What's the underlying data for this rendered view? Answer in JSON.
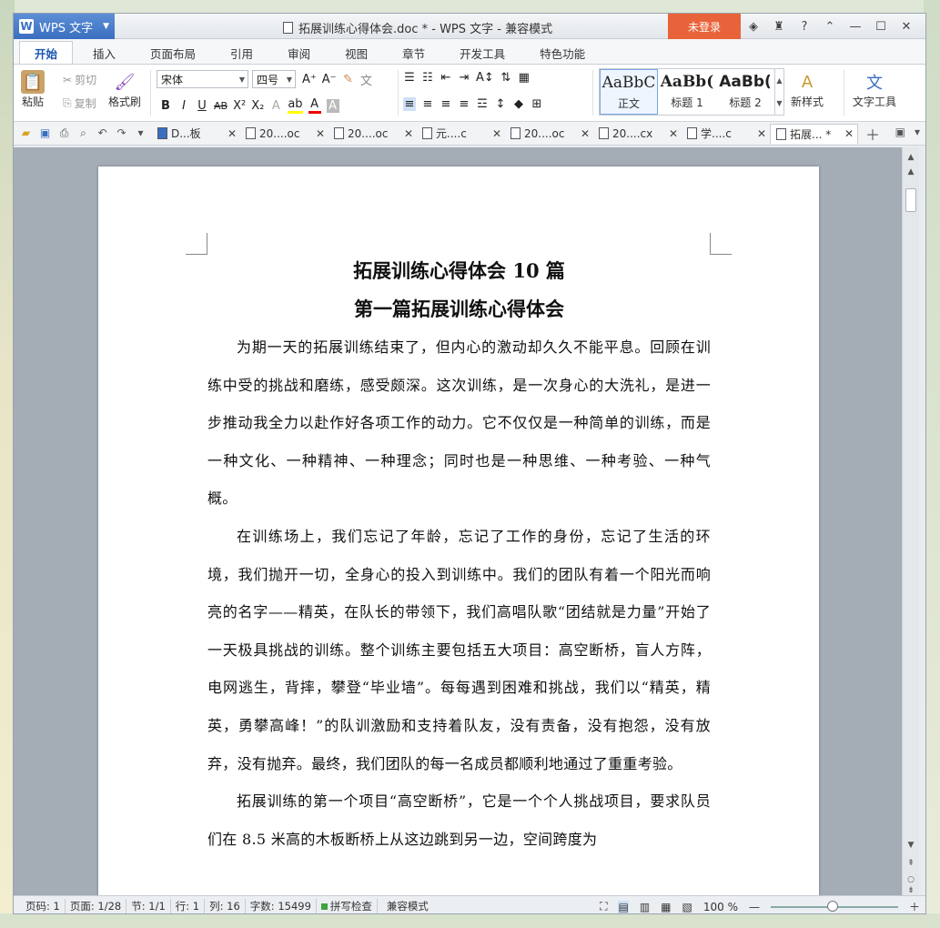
{
  "window": {
    "app_button": "WPS 文字",
    "title": "拓展训练心得体会.doc * - WPS 文字 - 兼容模式",
    "login": "未登录"
  },
  "ribbon_tabs": [
    "开始",
    "插入",
    "页面布局",
    "引用",
    "审阅",
    "视图",
    "章节",
    "开发工具",
    "特色功能"
  ],
  "ribbon": {
    "paste": "粘贴",
    "cut": "剪切",
    "copy": "复制",
    "format_painter": "格式刷",
    "font": "宋体",
    "size": "四号",
    "styles": [
      {
        "preview": "AaBbC",
        "label": "正文"
      },
      {
        "preview": "AaBb(",
        "label": "标题 1"
      },
      {
        "preview": "AaBb(",
        "label": "标题 2"
      }
    ],
    "new_style": "新样式",
    "text_tools": "文字工具"
  },
  "doc_tabs": [
    {
      "label": "D...板",
      "active": false
    },
    {
      "label": "20....oc",
      "active": false
    },
    {
      "label": "20....oc",
      "active": false
    },
    {
      "label": "元....c",
      "active": false
    },
    {
      "label": "20....oc",
      "active": false
    },
    {
      "label": "20....cx",
      "active": false
    },
    {
      "label": "学....c",
      "active": false
    },
    {
      "label": "拓展... *",
      "active": true
    }
  ],
  "document": {
    "title1": "拓展训练心得体会 10 篇",
    "title2": "第一篇拓展训练心得体会",
    "paragraphs": [
      "为期一天的拓展训练结束了，但内心的激动却久久不能平息。回顾在训练中受的挑战和磨练，感受颇深。这次训练，是一次身心的大洗礼，是进一步推动我全力以赴作好各项工作的动力。它不仅仅是一种简单的训练，而是一种文化、一种精神、一种理念；同时也是一种思维、一种考验、一种气概。",
      "在训练场上，我们忘记了年龄，忘记了工作的身份，忘记了生活的环境，我们抛开一切，全身心的投入到训练中。我们的团队有着一个阳光而响亮的名字——精英，在队长的带领下，我们高唱队歌“团结就是力量”开始了一天极具挑战的训练。整个训练主要包括五大项目：高空断桥，盲人方阵，电网逃生，背摔，攀登“毕业墙”。每每遇到困难和挑战，我们以“精英，精英，勇攀高峰！”的队训激励和支持着队友，没有责备，没有抱怨，没有放弃，没有抛弃。最终，我们团队的每一名成员都顺利地通过了重重考验。",
      "拓展训练的第一个项目“高空断桥”，它是一个个人挑战项目，要求队员们在 8.5 米高的木板断桥上从这边跳到另一边，空间跨度为"
    ]
  },
  "status": {
    "page": "页码: 1",
    "pages": "页面: 1/28",
    "section": "节: 1/1",
    "row": "行: 1",
    "col": "列: 16",
    "words": "字数: 15499",
    "spell": "拼写检查",
    "mode": "兼容模式",
    "zoom": "100 %"
  }
}
